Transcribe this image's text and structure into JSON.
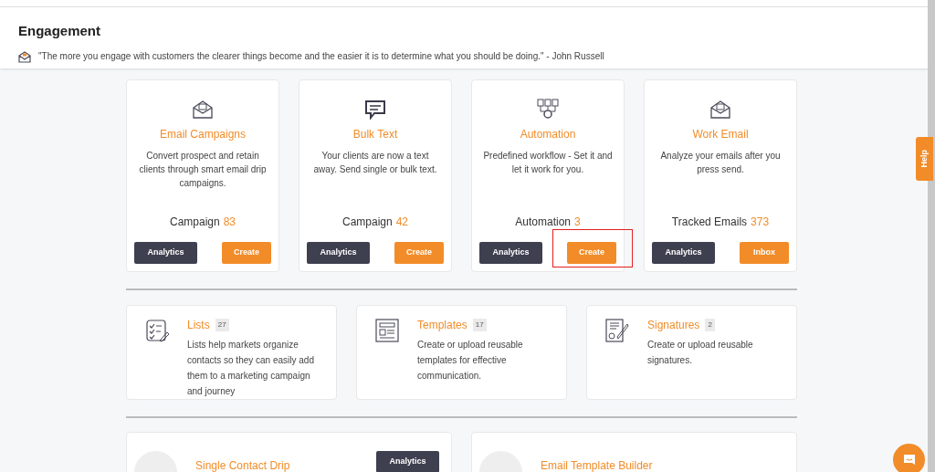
{
  "header": {
    "title": "Engagement",
    "quote": "\"The more you engage with customers the clearer things become and the easier it is to determine what you should be doing.\" - John Russell"
  },
  "feature_cards": [
    {
      "title": "Email Campaigns",
      "description": "Convert prospect and retain clients through smart email drip campaigns.",
      "count_label": "Campaign",
      "count": "83",
      "buttons": [
        {
          "label": "Analytics",
          "kind": "dark"
        },
        {
          "label": "Create",
          "kind": "orange"
        }
      ]
    },
    {
      "title": "Bulk Text",
      "description": "Your clients are now a text away. Send single or bulk text.",
      "count_label": "Campaign",
      "count": "42",
      "buttons": [
        {
          "label": "Analytics",
          "kind": "dark"
        },
        {
          "label": "Create",
          "kind": "orange"
        }
      ]
    },
    {
      "title": "Automation",
      "description": "Predefined workflow - Set it and let it work for you.",
      "count_label": "Automation",
      "count": "3",
      "buttons": [
        {
          "label": "Analytics",
          "kind": "dark"
        },
        {
          "label": "Create",
          "kind": "orange"
        }
      ]
    },
    {
      "title": "Work Email",
      "description": "Analyze your emails after you press send.",
      "count_label": "Tracked Emails",
      "count": "373",
      "buttons": [
        {
          "label": "Analytics",
          "kind": "dark"
        },
        {
          "label": "Inbox",
          "kind": "orange"
        }
      ]
    }
  ],
  "resource_cards": [
    {
      "title": "Lists",
      "count": "27",
      "description": "Lists help markets organize contacts so they can easily add them to a marketing campaign and journey"
    },
    {
      "title": "Templates",
      "count": "17",
      "description": "Create or upload reusable templates for effective communication."
    },
    {
      "title": "Signatures",
      "count": "2",
      "description": "Create or upload reusable signatures."
    }
  ],
  "builder_cards": [
    {
      "title": "Single Contact Drip",
      "button": "Analytics"
    },
    {
      "title": "Email Template Builder"
    }
  ],
  "help_tab": {
    "label": "Help"
  },
  "annotation": {
    "kind": "red-frame"
  }
}
